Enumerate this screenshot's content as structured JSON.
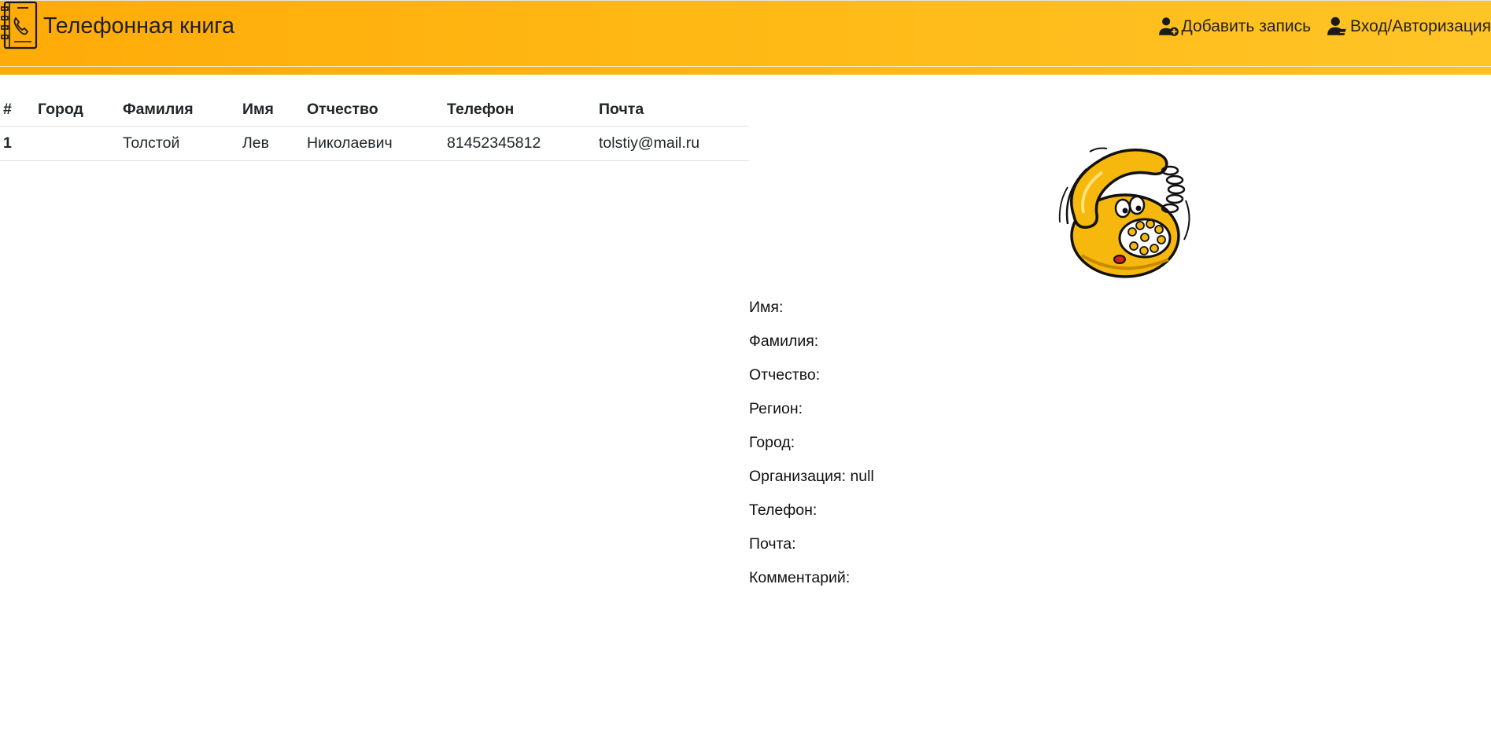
{
  "header": {
    "title": "Телефонная книга",
    "nav": [
      {
        "label": "Добавить запись",
        "icon": "add-user-icon"
      },
      {
        "label": "Вход/Авторизация",
        "icon": "user-login-icon"
      }
    ],
    "colors": {
      "gradient_start": "#ffab08",
      "gradient_end": "#ffc426"
    }
  },
  "table": {
    "columns": [
      "#",
      "Город",
      "Фамилия",
      "Имя",
      "Отчество",
      "Телефон",
      "Почта"
    ],
    "rows": [
      {
        "num": "1",
        "city": "",
        "last_name": "Толстой",
        "first_name": "Лев",
        "middle_name": "Николаевич",
        "phone": "81452345812",
        "email": "tolstiy@mail.ru"
      }
    ]
  },
  "details": {
    "image": "telephone-illustration",
    "fields": [
      {
        "label": "Имя:",
        "value": ""
      },
      {
        "label": "Фамилия:",
        "value": ""
      },
      {
        "label": "Отчество:",
        "value": ""
      },
      {
        "label": "Регион:",
        "value": ""
      },
      {
        "label": "Город:",
        "value": ""
      },
      {
        "label": "Организация:",
        "value": "null"
      },
      {
        "label": "Телефон:",
        "value": ""
      },
      {
        "label": "Почта:",
        "value": ""
      },
      {
        "label": "Комментарий:",
        "value": ""
      }
    ]
  }
}
